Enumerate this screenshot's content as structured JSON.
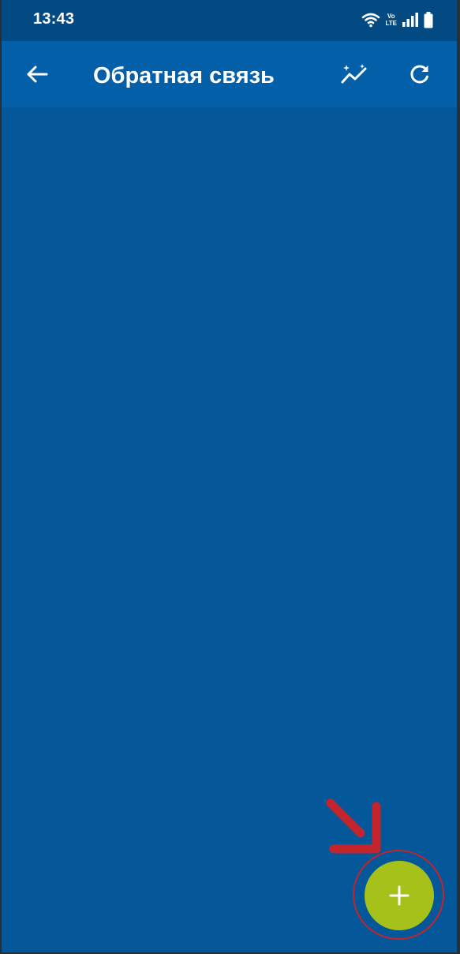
{
  "status_bar": {
    "time": "13:43",
    "volte_top": "Vo",
    "volte_bottom": "LTE",
    "icons": [
      "wifi-icon",
      "volte-icon",
      "signal-icon",
      "battery-icon"
    ]
  },
  "app_bar": {
    "title": "Обратная связь",
    "icons": [
      "back-arrow-icon",
      "chart-sparkle-icon",
      "refresh-icon"
    ]
  },
  "fab": {
    "icon": "plus-icon"
  },
  "colors": {
    "status_bar_bg": "#034a82",
    "app_bar_bg": "#0360a8",
    "content_bg": "#045799",
    "fab_bg": "#a6c21a",
    "annotation": "#c4242b"
  }
}
